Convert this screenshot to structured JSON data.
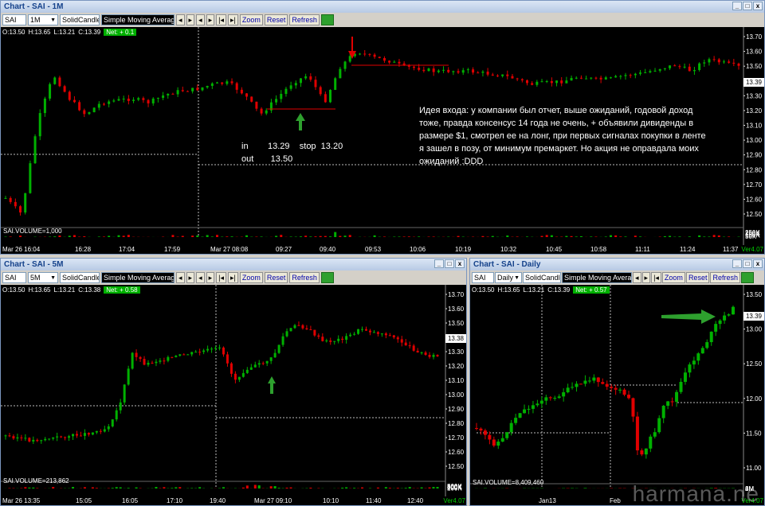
{
  "colors": {
    "up": "#00b000",
    "down": "#e00000",
    "grid": "#444444"
  },
  "toolbar_common": {
    "zoom": "Zoom",
    "reset": "Reset",
    "refresh": "Refresh",
    "study": "Simple Moving Average",
    "nav": [
      "◂",
      "▸",
      "◂",
      "▸",
      "|◂",
      "▸|"
    ]
  },
  "win1": {
    "title": "Chart - SAI - 1M",
    "symbol": "SAI",
    "interval": "1M",
    "chart_type": "SolidCandle",
    "ohlc": {
      "o": "O:13.50",
      "h": "H:13.65",
      "l": "L:13.21",
      "c": "C:13.39",
      "net": "Net: + 0.1"
    },
    "price_ticks": [
      "13.70",
      "13.60",
      "13.50",
      "13.40",
      "13.30",
      "13.20",
      "13.10",
      "13.00",
      "12.90",
      "12.80",
      "12.70",
      "12.60",
      "12.50"
    ],
    "last_price": "13.39",
    "volume_label": "SAI.VOLUME=1,000",
    "vol_ticks": [
      "250K",
      "200K",
      "150K",
      "100K",
      "50K"
    ],
    "time_labels": [
      "Mar 26 16:04",
      "16:28",
      "17:04",
      "17:59",
      "Mar 27 08:08",
      "09:27",
      "09:40",
      "09:53",
      "10:06",
      "10:19",
      "10:32",
      "10:45",
      "10:58",
      "11:11",
      "11:24",
      "11:37"
    ],
    "ver": "Ver4.07",
    "trade_lines": [
      "in        13.29    stop  13.20",
      "out       13.50"
    ],
    "note": "Идея входа: у компании был отчет, выше ожиданий, годовой доход тоже, правда консенсус 14 года не очень, + объявили дивиденды в размере $1, смотрел ее на лонг, при первых сигналах покупки в ленте я зашел в позу, от минимум премаркет. Но акция не оправдала моих ожиданий :DDD"
  },
  "win2": {
    "title": "Chart - SAI - 5M",
    "symbol": "SAI",
    "interval": "5M",
    "chart_type": "SolidCandle",
    "ohlc": {
      "o": "O:13.50",
      "h": "H:13.65",
      "l": "L:13.21",
      "c": "C:13.38",
      "net": "Net: + 0.58"
    },
    "price_ticks": [
      "13.70",
      "13.60",
      "13.50",
      "13.40",
      "13.30",
      "13.20",
      "13.10",
      "13.00",
      "12.90",
      "12.80",
      "12.70",
      "12.60",
      "12.50"
    ],
    "last_price": "13.38",
    "volume_label": "SAI.VOLUME=213,862",
    "vol_ticks": [
      "500K",
      "400K",
      "300K",
      "200K",
      "100K"
    ],
    "time_labels": [
      "Mar 26 13:35",
      "15:05",
      "16:05",
      "17:10",
      "19:40",
      "Mar 27 09:10",
      "10:10",
      "11:40",
      "12:40"
    ],
    "ver": "Ver4.07"
  },
  "win3": {
    "title": "Chart - SAI - Daily",
    "symbol": "SAI",
    "interval": "Daily",
    "chart_type": "SolidCandle",
    "ohlc": {
      "o": "O:13.50",
      "h": "H:13.65",
      "l": "L:13.21",
      "c": "C:13.39",
      "net": "Net: + 0.57"
    },
    "price_ticks": [
      "13.50",
      "13.00",
      "12.50",
      "12.00",
      "11.50",
      "11.00"
    ],
    "last_price": "13.39",
    "volume_label": "SAI.VOLUME=8,409,460",
    "vol_ticks": [
      "6M",
      "4M",
      "2M"
    ],
    "time_labels": [
      "Jan13",
      "Feb"
    ],
    "ver": "Ver4.07"
  },
  "watermark": "harmana.ne"
}
